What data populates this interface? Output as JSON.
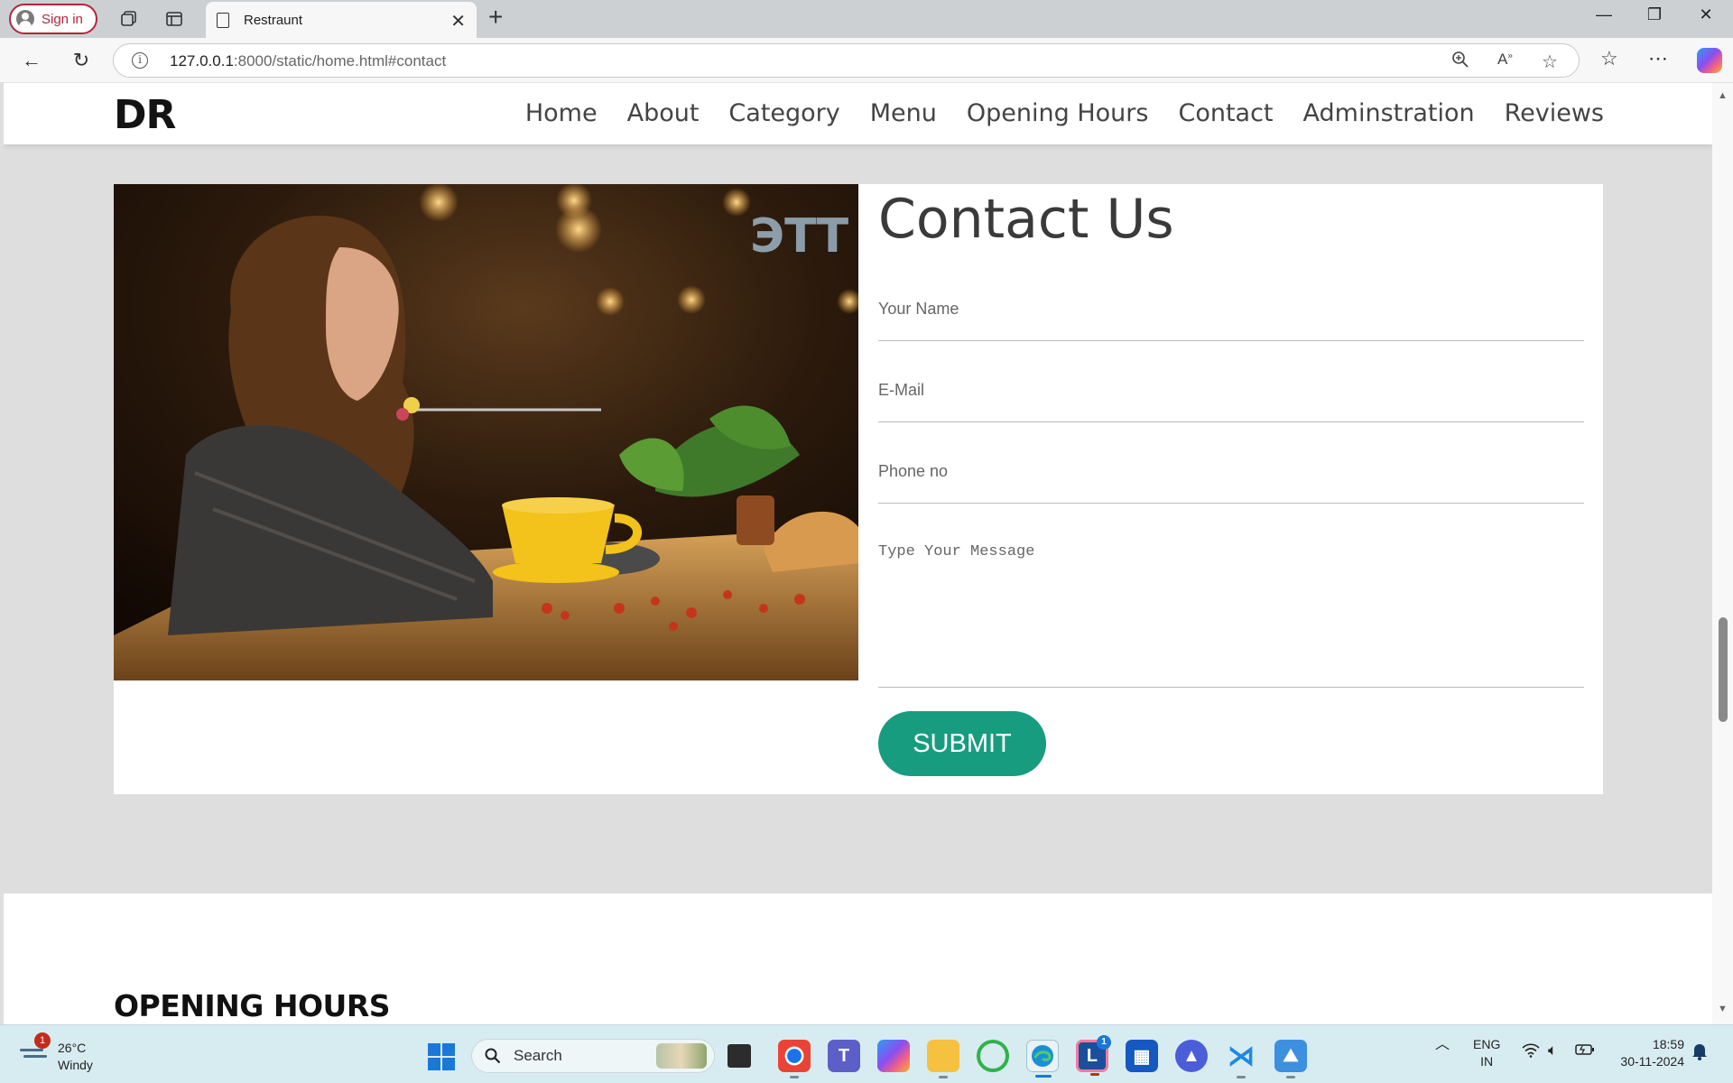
{
  "browser": {
    "signin_label": "Sign in",
    "tab_title": "Restraunt",
    "url_host": "127.0.0.1",
    "url_rest": ":8000/static/home.html#contact"
  },
  "site": {
    "logo": "DR",
    "nav": [
      "Home",
      "About",
      "Category",
      "Menu",
      "Opening Hours",
      "Contact",
      "Adminstration",
      "Reviews"
    ]
  },
  "contact": {
    "title": "Contact Us",
    "name_placeholder": "Your Name",
    "email_placeholder": "E-Mail",
    "phone_placeholder": "Phone no",
    "message_placeholder": "Type Your Message",
    "submit_label": "SUBMIT",
    "accent_color": "#189c7f"
  },
  "next_section": {
    "title": "OPENING HOURS"
  },
  "taskbar": {
    "weather_badge": "1",
    "temperature": "26°C",
    "condition": "Windy",
    "search_label": "Search",
    "lang_line1": "ENG",
    "lang_line2": "IN",
    "time": "18:59",
    "date": "30-11-2024",
    "mail_badge": "1"
  }
}
